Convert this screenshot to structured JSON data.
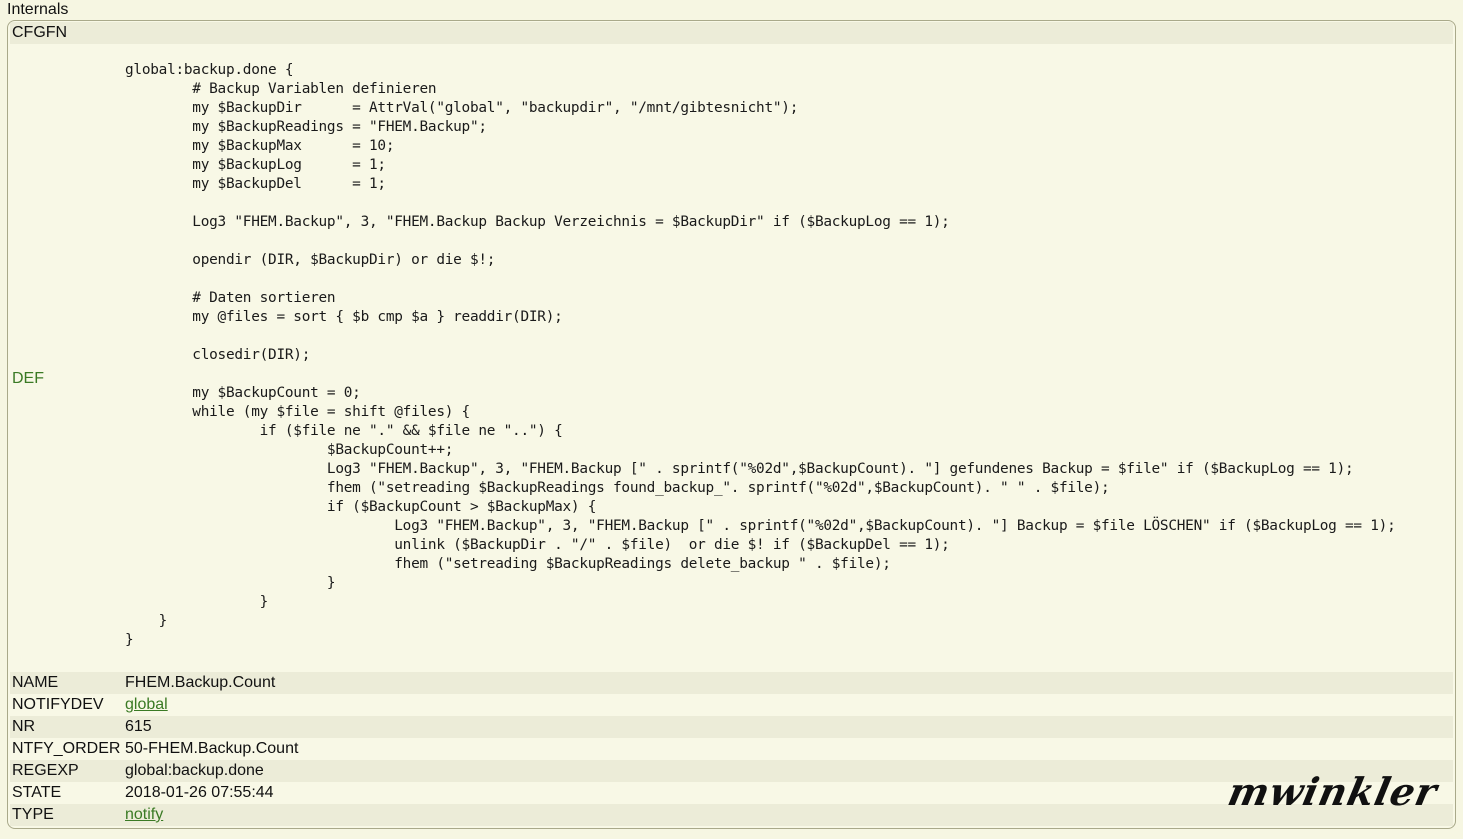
{
  "section": {
    "title": "Internals"
  },
  "internals": {
    "cfgfn": {
      "key": "CFGFN",
      "value": ""
    },
    "def": {
      "key": "DEF",
      "code": "global:backup.done {\n        # Backup Variablen definieren\n        my $BackupDir      = AttrVal(\"global\", \"backupdir\", \"/mnt/gibtesnicht\");\n        my $BackupReadings = \"FHEM.Backup\";\n        my $BackupMax      = 10;\n        my $BackupLog      = 1;\n        my $BackupDel      = 1;\n\n        Log3 \"FHEM.Backup\", 3, \"FHEM.Backup Backup Verzeichnis = $BackupDir\" if ($BackupLog == 1);\n\n        opendir (DIR, $BackupDir) or die $!;\n\n        # Daten sortieren\n        my @files = sort { $b cmp $a } readdir(DIR);\n\n        closedir(DIR);\n\n        my $BackupCount = 0;\n        while (my $file = shift @files) {\n                if ($file ne \".\" && $file ne \"..\") {\n                        $BackupCount++;\n                        Log3 \"FHEM.Backup\", 3, \"FHEM.Backup [\" . sprintf(\"%02d\",$BackupCount). \"] gefundenes Backup = $file\" if ($BackupLog == 1);\n                        fhem (\"setreading $BackupReadings found_backup_\". sprintf(\"%02d\",$BackupCount). \" \" . $file);\n                        if ($BackupCount > $BackupMax) {\n                                Log3 \"FHEM.Backup\", 3, \"FHEM.Backup [\" . sprintf(\"%02d\",$BackupCount). \"] Backup = $file LÖSCHEN\" if ($BackupLog == 1);\n                                unlink ($BackupDir . \"/\" . $file)  or die $! if ($BackupDel == 1);\n                                fhem (\"setreading $BackupReadings delete_backup \" . $file);\n                        }\n                }\n    }\n}"
    },
    "name": {
      "key": "NAME",
      "value": "FHEM.Backup.Count"
    },
    "notifydev": {
      "key": "NOTIFYDEV",
      "value": "global"
    },
    "nr": {
      "key": "NR",
      "value": "615"
    },
    "ntfy_order": {
      "key": "NTFY_ORDER",
      "value": "50-FHEM.Backup.Count"
    },
    "regexp": {
      "key": "REGEXP",
      "value": "global:backup.done"
    },
    "state": {
      "key": "STATE",
      "value": "2018-01-26 07:55:44"
    },
    "type": {
      "key": "TYPE",
      "value": "notify"
    }
  },
  "signature": {
    "text": "mwinkler"
  },
  "colors": {
    "background": "#f6f6e2",
    "row_stripe": "#ececd8",
    "link": "#3a7a24",
    "border": "#a9a98a"
  }
}
